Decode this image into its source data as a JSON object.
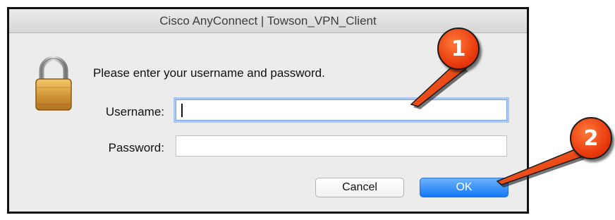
{
  "window": {
    "title": "Cisco AnyConnect | Towson_VPN_Client"
  },
  "icons": {
    "lock": "lock-icon"
  },
  "form": {
    "prompt": "Please enter your username and password.",
    "username_label": "Username:",
    "username_value": "",
    "password_label": "Password:",
    "password_value": ""
  },
  "buttons": {
    "cancel_label": "Cancel",
    "ok_label": "OK"
  },
  "annotations": {
    "step1": "1",
    "step2": "2",
    "color": "#e8380b"
  },
  "colors": {
    "ok_button": "#1479f7",
    "focus_ring": "#a9c8f2",
    "dialog_bg": "#ececec"
  }
}
